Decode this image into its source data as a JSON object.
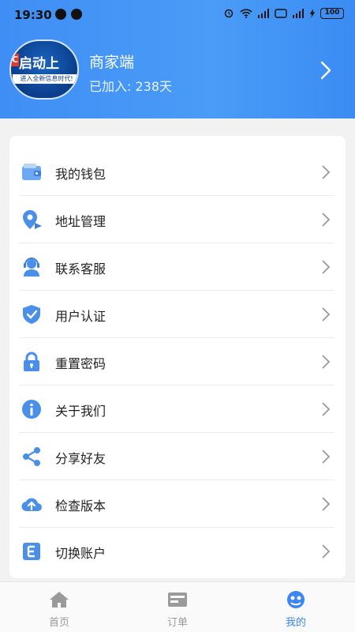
{
  "status": {
    "time": "19:30",
    "battery": "100"
  },
  "profile": {
    "avatar_text": "启动上",
    "avatar_subtext": "进入全新信息时代!",
    "name": "商家端",
    "joined": "已加入: 238天"
  },
  "menu": [
    {
      "label": "我的钱包",
      "icon": "wallet-icon"
    },
    {
      "label": "地址管理",
      "icon": "location-pin-icon"
    },
    {
      "label": "联系客服",
      "icon": "customer-service-icon"
    },
    {
      "label": "用户认证",
      "icon": "shield-check-icon"
    },
    {
      "label": "重置密码",
      "icon": "lock-icon"
    },
    {
      "label": "关于我们",
      "icon": "info-icon"
    },
    {
      "label": "分享好友",
      "icon": "share-icon"
    },
    {
      "label": "检查版本",
      "icon": "cloud-upload-icon"
    },
    {
      "label": "切换账户",
      "icon": "switch-account-icon"
    }
  ],
  "tabs": [
    {
      "label": "首页",
      "icon": "home-icon",
      "active": false
    },
    {
      "label": "订单",
      "icon": "order-icon",
      "active": false
    },
    {
      "label": "我的",
      "icon": "profile-icon",
      "active": true
    }
  ],
  "colors": {
    "accent": "#3b86f0",
    "header": "#4a9cf7",
    "icon": "#4a8fe8"
  }
}
